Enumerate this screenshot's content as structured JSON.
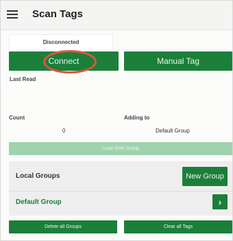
{
  "header": {
    "title": "Scan Tags",
    "menu_icon": "hamburger-menu-icon"
  },
  "status": {
    "text": "Disconnected"
  },
  "buttons": {
    "connect": "Connect",
    "manual_tag": "Manual Tag",
    "load_stick_group": "Load Stick Group",
    "new_group": "New Group",
    "delete_all_groups": "Delete all Groups",
    "clear_all_tags": "Clear all Tags"
  },
  "fields": {
    "last_read_label": "Last Read",
    "count_label": "Count",
    "count_value": "0",
    "adding_to_label": "Adding to",
    "adding_to_value": "Default Group"
  },
  "groups": {
    "title": "Local Groups",
    "items": [
      {
        "name": "Default Group",
        "action_icon": "chevron-right-icon"
      }
    ]
  },
  "colors": {
    "primary_green": "#1b7f3a",
    "disabled_green": "#9fd3ad",
    "highlight_ring": "#e2553a"
  }
}
